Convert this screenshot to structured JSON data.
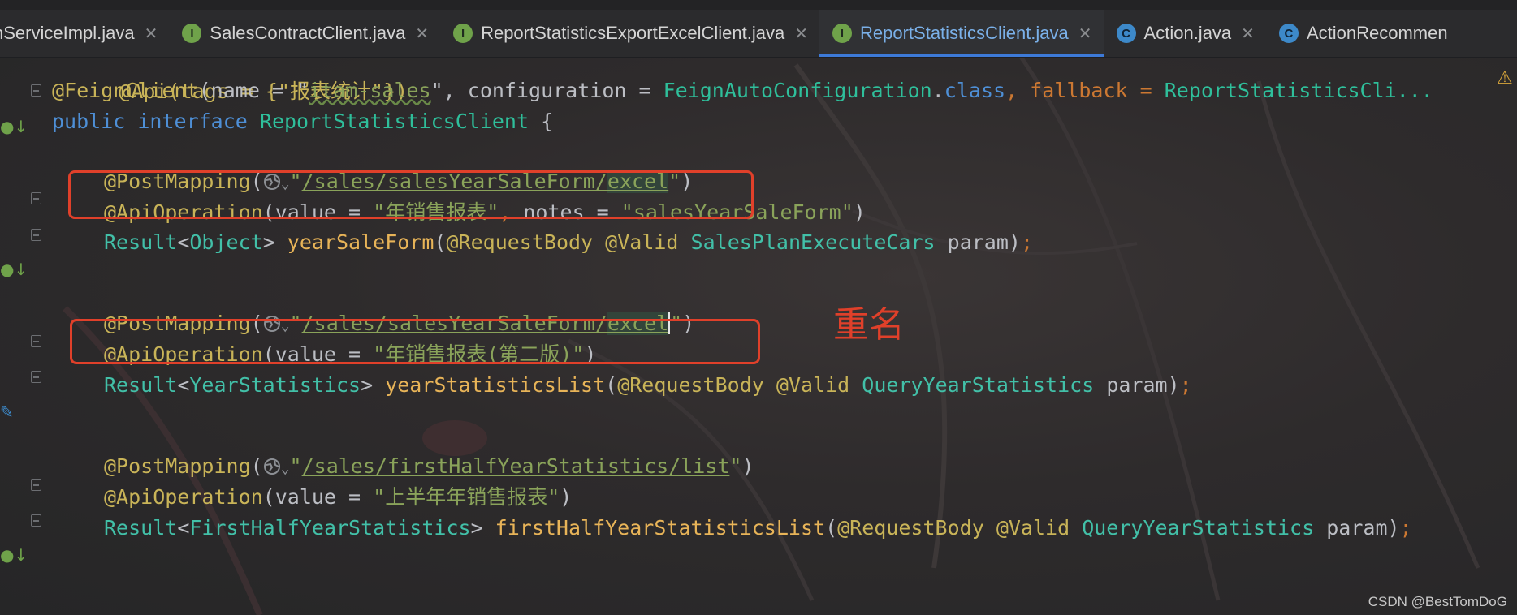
{
  "tabs": [
    {
      "label": "nServiceImpl.java",
      "icon": "none",
      "active": false
    },
    {
      "label": "SalesContractClient.java",
      "icon": "interface-icon",
      "active": false
    },
    {
      "label": "ReportStatisticsExportExcelClient.java",
      "icon": "interface-icon",
      "active": false
    },
    {
      "label": "ReportStatisticsClient.java",
      "icon": "interface-icon",
      "active": true
    },
    {
      "label": "Action.java",
      "icon": "class-icon",
      "active": false
    },
    {
      "label": "ActionRecommen",
      "icon": "class-icon",
      "active": false
    }
  ],
  "code": {
    "l0": "@Api(tags = {\"报表统计\"})",
    "l1_ann": "@FeignClient",
    "l1_a": "(name = \"",
    "l1_name": "itam-sales",
    "l1_b": "\", configuration = ",
    "l1_cfg": "FeignAutoConfiguration",
    "l1_dot": ".",
    "l1_class": "class",
    "l1_c": ", fallback = ",
    "l1_fb": "ReportStatisticsCli...",
    "l2_pub": "public",
    "l2_iface": "interface",
    "l2_name": "ReportStatisticsClient",
    "l2_brace": " {",
    "pm": "@PostMapping",
    "ao": "@ApiOperation",
    "rb": "@RequestBody",
    "valid": "@Valid",
    "result": "Result",
    "b1_url_a": "/sales/salesYearSaleForm/",
    "b1_url_b": "excel",
    "b1_value": "\"年销售报表\"",
    "b1_notes": "\"salesYearSaleForm\"",
    "b1_type": "Object",
    "b1_method": "yearSaleForm",
    "b1_param_type": "SalesPlanExecuteCars",
    "b2_url_a": "/sales/salesYearSaleForm/",
    "b2_url_b": "excel",
    "b2_value": "\"年销售报表(第二版)\"",
    "b2_type": "YearStatistics",
    "b2_method": "yearStatisticsList",
    "b2_param_type": "QueryYearStatistics",
    "b3_url": "/sales/firstHalfYearStatistics/list",
    "b3_value": "\"上半年年销售报表\"",
    "b3_type": "FirstHalfYearStatistics",
    "b3_method": "firstHalfYearStatisticsList",
    "b3_param_type": "QueryYearStatistics",
    "param": "param"
  },
  "annotation_note": "重名",
  "watermark": "CSDN @BestTomDoG",
  "colors": {
    "keyword": "#4e8fd6",
    "annotation": "#c9b458",
    "string": "#8aa35a",
    "type": "#42c0a8",
    "method": "#e8b458",
    "highlight_box": "#e0402a",
    "active_tab": "#7ab0e8"
  }
}
